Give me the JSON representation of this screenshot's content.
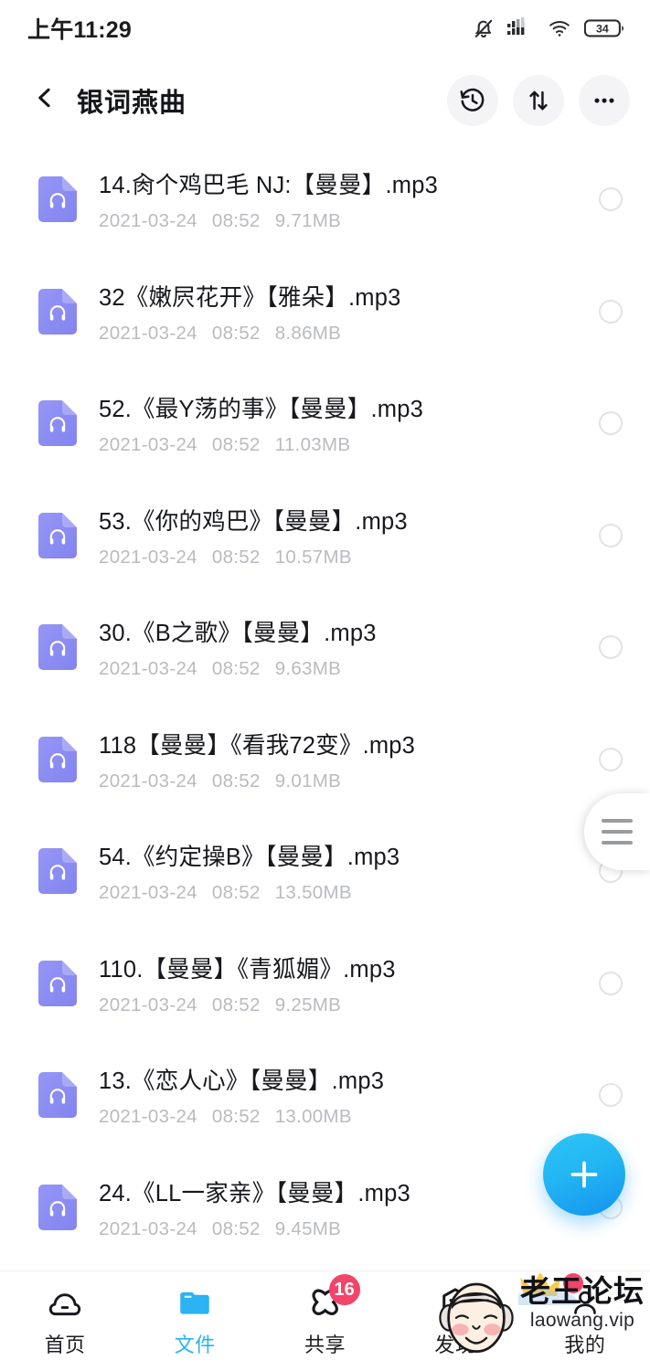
{
  "status_bar": {
    "time": "上午11:29",
    "icons": [
      "bell-muted-icon",
      "cellular-signal-icon",
      "wifi-icon",
      "battery-icon"
    ],
    "battery_level": "34"
  },
  "app_bar": {
    "back_icon": "chevron-left-icon",
    "title": "银词燕曲",
    "actions": [
      {
        "name": "history-button",
        "icon": "history-clock-icon"
      },
      {
        "name": "sort-button",
        "icon": "sort-arrows-icon"
      },
      {
        "name": "more-button",
        "icon": "more-horizontal-icon"
      }
    ]
  },
  "file_list": {
    "item_icon": "audio-file-icon",
    "select_control": "select-circle",
    "items": [
      {
        "name": "14.肏个鸡巴毛 NJ:【曼曼】.mp3",
        "date": "2021-03-24",
        "time": "08:52",
        "size": "9.71MB"
      },
      {
        "name": "32《嫩屄花开》【雅朵】.mp3",
        "date": "2021-03-24",
        "time": "08:52",
        "size": "8.86MB"
      },
      {
        "name": "52.《最Y荡的事》【曼曼】.mp3",
        "date": "2021-03-24",
        "time": "08:52",
        "size": "11.03MB"
      },
      {
        "name": "53.《你的鸡巴》【曼曼】.mp3",
        "date": "2021-03-24",
        "time": "08:52",
        "size": "10.57MB"
      },
      {
        "name": "30.《B之歌》【曼曼】.mp3",
        "date": "2021-03-24",
        "time": "08:52",
        "size": "9.63MB"
      },
      {
        "name": "118【曼曼】《看我72变》.mp3",
        "date": "2021-03-24",
        "time": "08:52",
        "size": "9.01MB"
      },
      {
        "name": "54.《约定操B》【曼曼】.mp3",
        "date": "2021-03-24",
        "time": "08:52",
        "size": "13.50MB"
      },
      {
        "name": "110.【曼曼】《青狐媚》.mp3",
        "date": "2021-03-24",
        "time": "08:52",
        "size": "9.25MB"
      },
      {
        "name": "13.《恋人心》【曼曼】.mp3",
        "date": "2021-03-24",
        "time": "08:52",
        "size": "13.00MB"
      },
      {
        "name": "24.《LL一家亲》【曼曼】.mp3",
        "date": "2021-03-24",
        "time": "08:52",
        "size": "9.45MB"
      }
    ]
  },
  "scroll_handle": {
    "icon": "drag-handle-icon"
  },
  "fab": {
    "icon": "plus-icon",
    "label": "+"
  },
  "bottom_nav": {
    "items": [
      {
        "label": "首页",
        "icon": "cloud-icon",
        "active": false,
        "badge": null
      },
      {
        "label": "文件",
        "icon": "folder-icon",
        "active": true,
        "badge": null
      },
      {
        "label": "共享",
        "icon": "share-atom-icon",
        "active": false,
        "badge": "16"
      },
      {
        "label": "发现",
        "icon": "hexagon-chevron-icon",
        "active": false,
        "badge": null
      },
      {
        "label": "我的",
        "icon": "user-icon",
        "active": false,
        "badge": null
      }
    ]
  },
  "watermark": {
    "title": "老王论坛",
    "subtitle": "laowang.vip",
    "face_icon": "old-man-face-icon"
  },
  "colors": {
    "accent": "#2bb3f3",
    "file_icon": "#8b8cf0",
    "badge": "#f3446a",
    "text_primary": "#17181c",
    "text_secondary": "#b9bbc0"
  }
}
